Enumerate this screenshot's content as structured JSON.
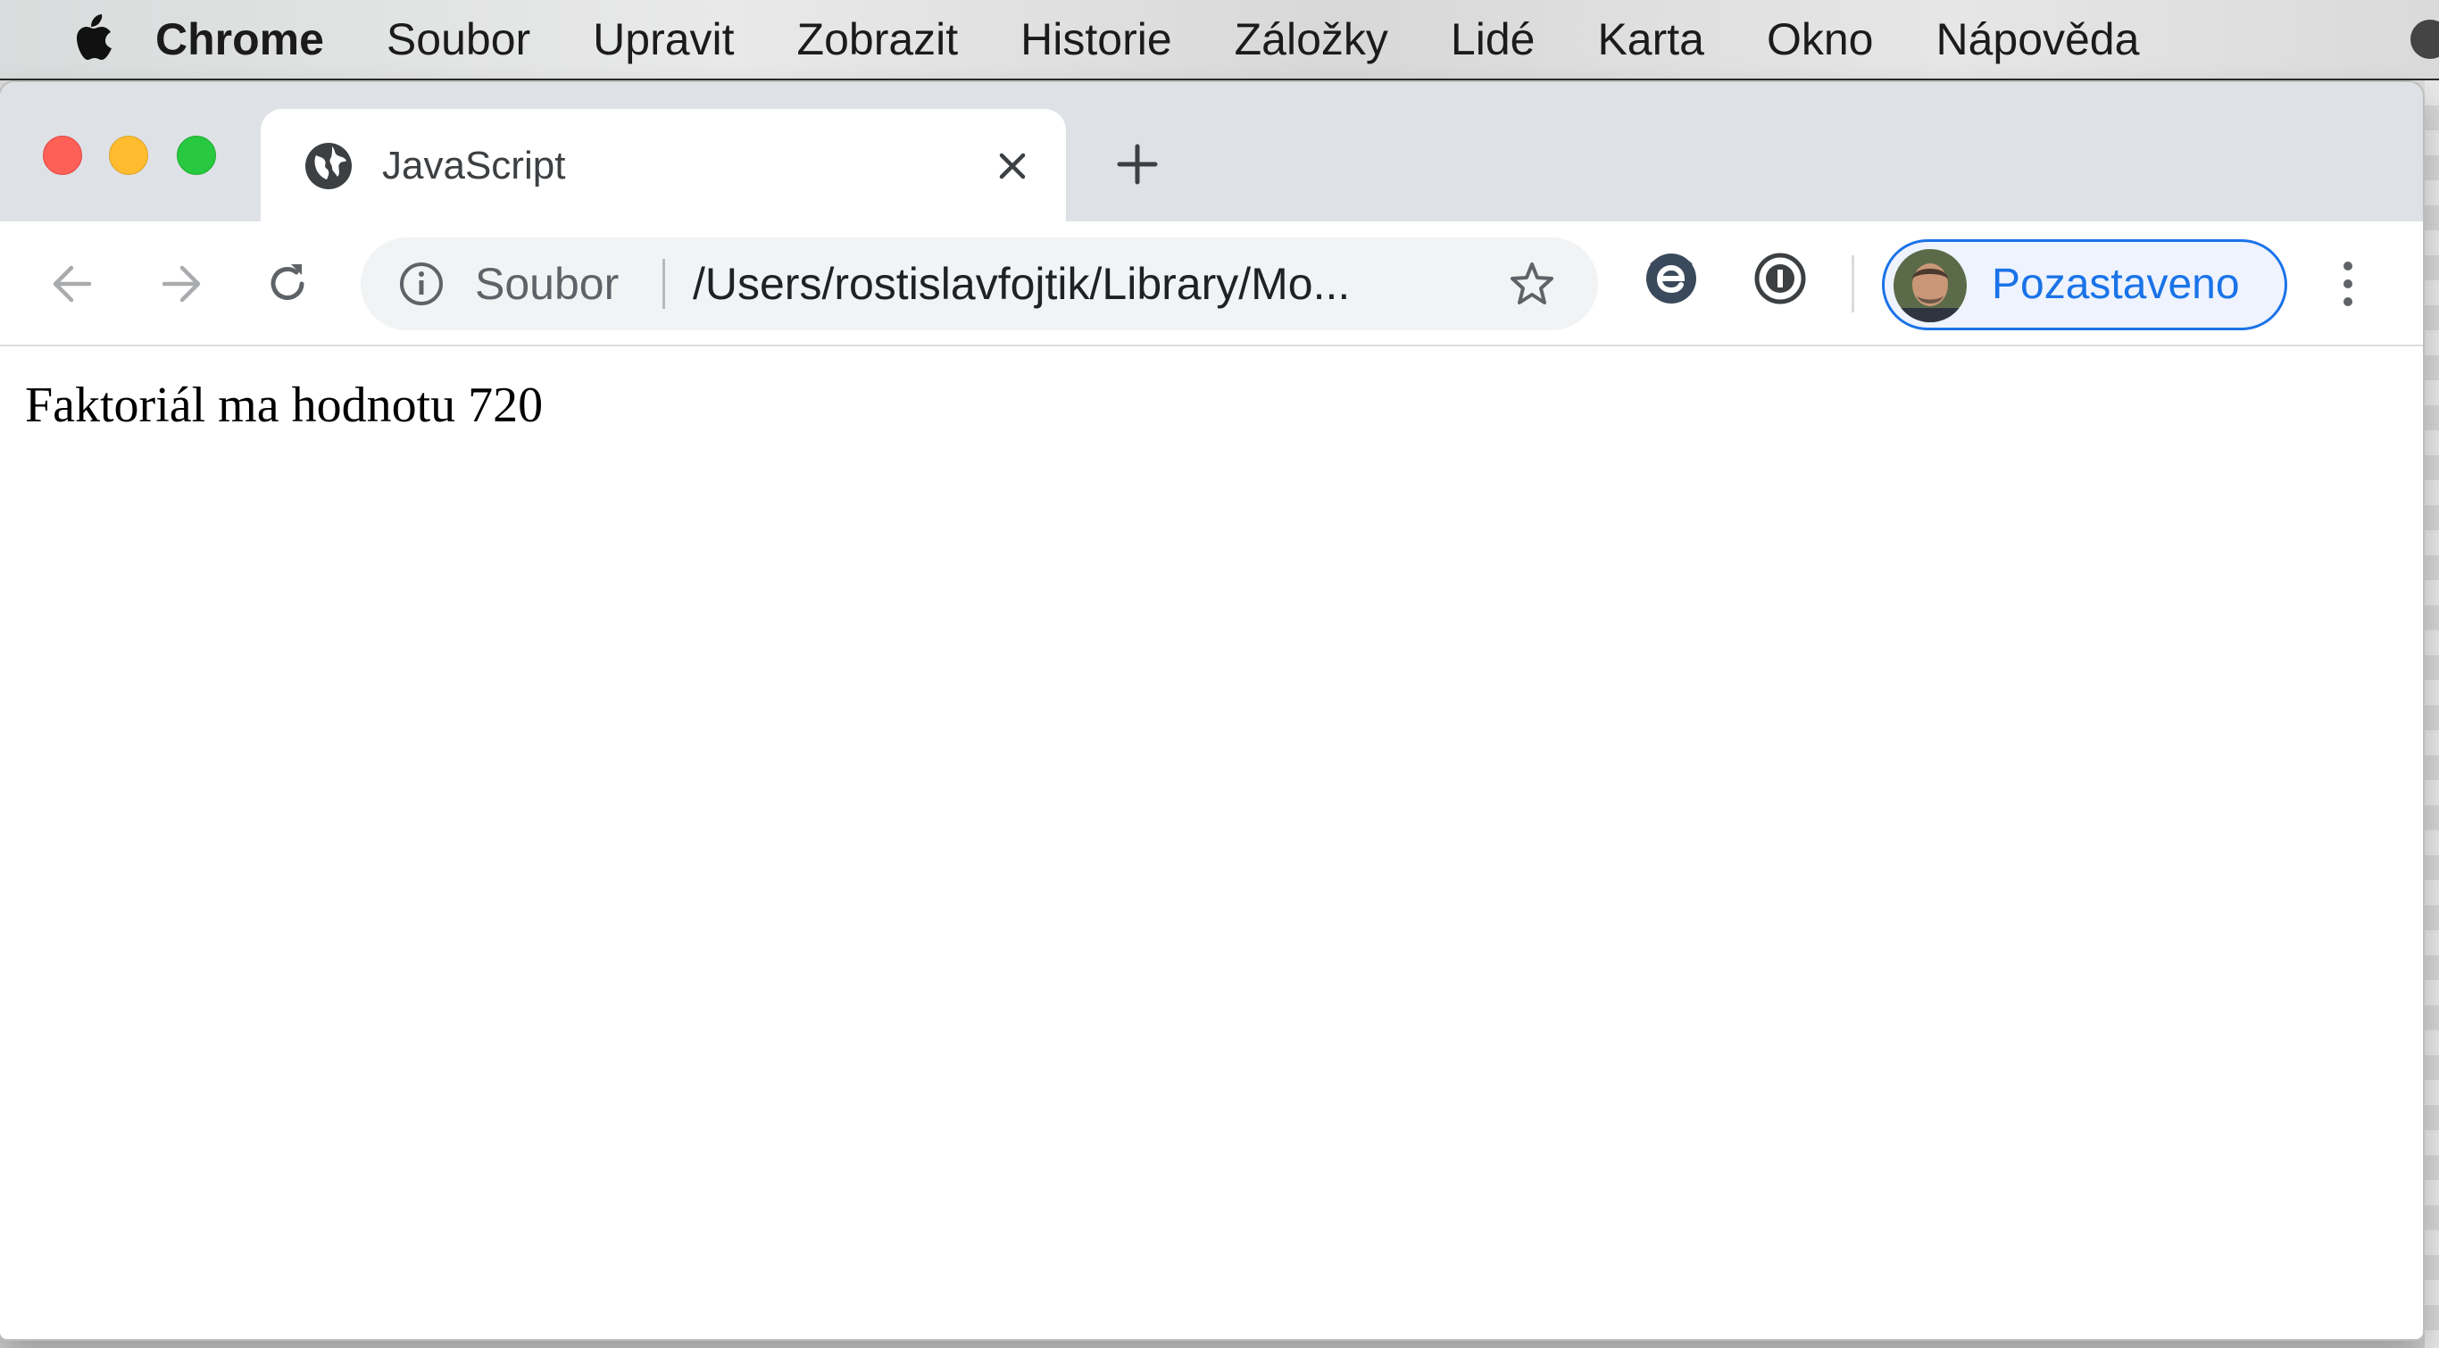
{
  "menubar": {
    "app_name": "Chrome",
    "items": [
      "Soubor",
      "Upravit",
      "Zobrazit",
      "Historie",
      "Záložky",
      "Lidé",
      "Karta",
      "Okno",
      "Nápověda"
    ]
  },
  "browser": {
    "tab": {
      "title": "JavaScript",
      "favicon": "globe-icon"
    },
    "omnibox": {
      "scheme_label": "Soubor",
      "url": "/Users/rostislavfojtik/Library/Mo..."
    },
    "profile": {
      "label": "Pozastaveno"
    }
  },
  "page": {
    "text": "Faktoriál ma hodnotu 720"
  },
  "colors": {
    "accent": "#1a73e8",
    "close_red": "#fe5f57",
    "minimize_yellow": "#febc2e",
    "zoom_green": "#28c840"
  }
}
